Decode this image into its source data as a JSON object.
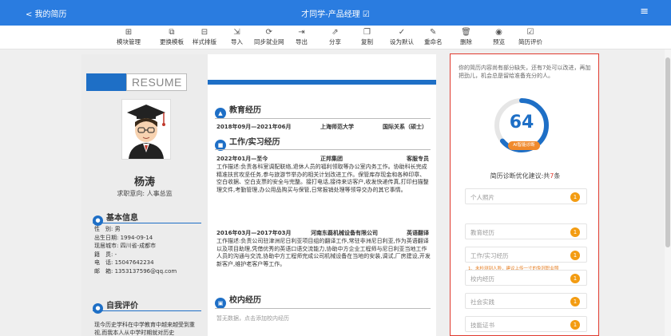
{
  "topbar": {
    "back_label": "< 我的简历",
    "title": "才同学-产品经理 ☑",
    "menu_icon": "≡"
  },
  "toolbar": {
    "items": [
      {
        "label": "模块管理",
        "icon": "⊞"
      },
      {
        "label": "更换模板",
        "icon": "⧉"
      },
      {
        "label": "样式排版",
        "icon": "⊟"
      },
      {
        "label": "导入",
        "icon": "⇲"
      },
      {
        "label": "同步就业网",
        "icon": "⟳"
      },
      {
        "label": "导出",
        "icon": "⇥"
      },
      {
        "label": "分享",
        "icon": "⇗"
      },
      {
        "label": "复制",
        "icon": "❐"
      },
      {
        "label": "设为默认",
        "icon": "✓"
      },
      {
        "label": "重命名",
        "icon": "✎"
      },
      {
        "label": "删除",
        "icon": "🗑"
      },
      {
        "label": "预览",
        "icon": "◉"
      },
      {
        "label": "简历评价",
        "icon": "☑"
      }
    ]
  },
  "resume": {
    "header": "RESUME",
    "name": "杨涛",
    "intent": "求职意向: 人事总监",
    "basic_title": "基本信息",
    "info": [
      "性　别: 男",
      "出生日期: 1994-09-14",
      "现居城市: 四川省-成都市",
      "籍　贯: -",
      "电　话: 15047642234",
      "邮　箱: 1353137596@qq.com"
    ],
    "self_title": "自我评价",
    "self_text": "现今历史学科在中学教育中越来越受到重视,而我本人从中学时期就对历史",
    "edu_title": "教育经历",
    "edu": {
      "date": "2018年09月—2021年06月",
      "school": "上海师范大学",
      "major": "国际关系（硕士）"
    },
    "work_title": "工作/实习经历",
    "jobs": [
      {
        "date": "2022年01月—至今",
        "company": "正邦集团",
        "role": "客服专员",
        "desc": "工作描述:负责各科室调配联络,退休人员的福利领取等办公室内务工作。协助科长完成精准扶贫攻坚任务,参与旅游节举办的相关计划改进工作。保管库存现金和各种印章、空白收据、空白支票的安全与完整。接打电话,接待来访客户,收发快递传真,打印扫描整理文件,考勤管理,办公用品购买与保管,日常报销处理等领导交办的其它事情。"
      },
      {
        "date": "2016年03月—2017年03月",
        "company": "河南东磊机械设备有限公司",
        "role": "英语翻译",
        "desc": "工作描述:负责公司驻津洲尼日利亚项目组的翻译工作,常驻非洲尼日利亚,作为英语翻译以及项目助理,凭借优秀的英语口语交流能力,协助中方企业工程师与尼日利亚当地工作人员的沟通与交流,协助中方工程师完成公司机械设备在当地的安装,调试,厂房建设,开发新客户,维护老客户等工作。"
      }
    ],
    "campus_title": "校内经历",
    "campus_empty": "暂无数据，点击添加校内经历"
  },
  "panel": {
    "tip": "你的简历内容尚有部分缺失，还有7处可以改进，再加把劲儿，机会总是留给准备充分的人。",
    "score": "64",
    "score_max": 100,
    "badge": "AI智能诊断",
    "advice_prefix": "简历诊断优化建议:共",
    "advice_count": "7",
    "advice_suffix": "条",
    "items": [
      {
        "label": "个人照片",
        "count": "1"
      },
      {
        "label": "教育经历",
        "count": "1"
      },
      {
        "label": "工作/实习经历",
        "count": "1"
      },
      {
        "label": "校内经历",
        "count": "1"
      },
      {
        "label": "社会实践",
        "count": "1"
      },
      {
        "label": "技能证书",
        "count": "1"
      }
    ],
    "warning": "1、未检测到人脸，建议上传一寸的免冠职业照"
  }
}
